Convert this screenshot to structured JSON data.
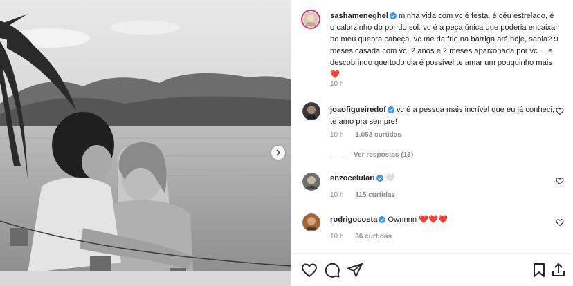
{
  "post": {
    "author": "sashameneghel",
    "caption": "minha vida com vc é festa, é céu estrelado, é o calorzinho do por do sol. vc é a peça única que poderia encaixar no meu quebra cabeça. vc me da frio na barriga até hoje, sabia? 9 meses casada com vc ,2 anos e 2 meses apaixonada por vc ... e descobrindo que todo dia é possível te amar um pouquinho mais",
    "caption_emoji": "❤️",
    "time": "10 h"
  },
  "comments": [
    {
      "author": "joaofigueiredof",
      "text": "vc é a pessoa mais incrível que eu já conheci, te amo pra sempre!",
      "time": "10 h",
      "likes": "1.053 curtidas",
      "replies": "Ver respostas (13)"
    },
    {
      "author": "enzocelulari",
      "text": "🤍",
      "time": "10 h",
      "likes": "115 curtidas"
    },
    {
      "author": "rodrigocosta",
      "text": "Ownnnn",
      "emoji": "❤️❤️❤️",
      "time": "10 h",
      "likes": "36 curtidas"
    }
  ],
  "icons": {
    "verified": "verified-badge-icon",
    "like": "heart-icon",
    "comment": "comment-icon",
    "share": "send-icon",
    "save": "bookmark-icon",
    "next": "chevron-right-icon"
  },
  "colors": {
    "verified": "#3897f0",
    "heart": "#ed4956",
    "meta": "#8e8e8e",
    "text": "#262626"
  }
}
